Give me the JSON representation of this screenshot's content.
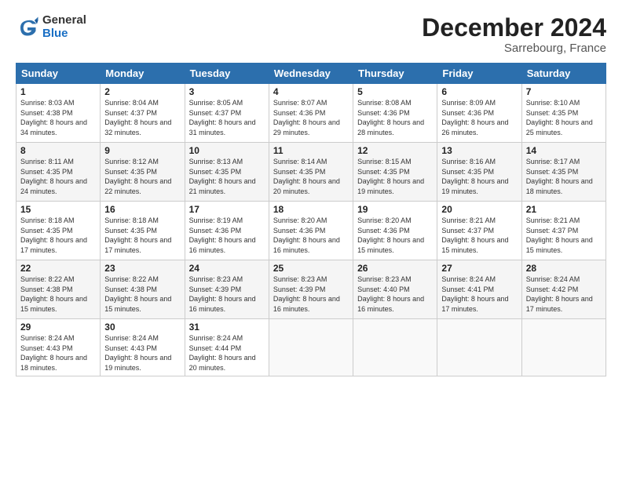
{
  "header": {
    "logo": {
      "general": "General",
      "blue": "Blue"
    },
    "title": "December 2024",
    "location": "Sarrebourg, France"
  },
  "calendar": {
    "days_of_week": [
      "Sunday",
      "Monday",
      "Tuesday",
      "Wednesday",
      "Thursday",
      "Friday",
      "Saturday"
    ],
    "weeks": [
      [
        null,
        {
          "date": "2",
          "sunrise": "8:04 AM",
          "sunset": "4:37 PM",
          "daylight": "8 hours and 32 minutes."
        },
        {
          "date": "3",
          "sunrise": "8:05 AM",
          "sunset": "4:37 PM",
          "daylight": "8 hours and 31 minutes."
        },
        {
          "date": "4",
          "sunrise": "8:07 AM",
          "sunset": "4:36 PM",
          "daylight": "8 hours and 29 minutes."
        },
        {
          "date": "5",
          "sunrise": "8:08 AM",
          "sunset": "4:36 PM",
          "daylight": "8 hours and 28 minutes."
        },
        {
          "date": "6",
          "sunrise": "8:09 AM",
          "sunset": "4:36 PM",
          "daylight": "8 hours and 26 minutes."
        },
        {
          "date": "7",
          "sunrise": "8:10 AM",
          "sunset": "4:35 PM",
          "daylight": "8 hours and 25 minutes."
        }
      ],
      [
        {
          "date": "1",
          "sunrise": "8:03 AM",
          "sunset": "4:38 PM",
          "daylight": "8 hours and 34 minutes."
        },
        {
          "date": "8",
          "sunrise": "8:11 AM",
          "sunset": "4:35 PM",
          "daylight": "8 hours and 24 minutes."
        },
        {
          "date": "9",
          "sunrise": "8:12 AM",
          "sunset": "4:35 PM",
          "daylight": "8 hours and 22 minutes."
        },
        {
          "date": "10",
          "sunrise": "8:13 AM",
          "sunset": "4:35 PM",
          "daylight": "8 hours and 21 minutes."
        },
        {
          "date": "11",
          "sunrise": "8:14 AM",
          "sunset": "4:35 PM",
          "daylight": "8 hours and 20 minutes."
        },
        {
          "date": "12",
          "sunrise": "8:15 AM",
          "sunset": "4:35 PM",
          "daylight": "8 hours and 19 minutes."
        },
        {
          "date": "13",
          "sunrise": "8:16 AM",
          "sunset": "4:35 PM",
          "daylight": "8 hours and 19 minutes."
        },
        {
          "date": "14",
          "sunrise": "8:17 AM",
          "sunset": "4:35 PM",
          "daylight": "8 hours and 18 minutes."
        }
      ],
      [
        {
          "date": "15",
          "sunrise": "8:18 AM",
          "sunset": "4:35 PM",
          "daylight": "8 hours and 17 minutes."
        },
        {
          "date": "16",
          "sunrise": "8:18 AM",
          "sunset": "4:35 PM",
          "daylight": "8 hours and 17 minutes."
        },
        {
          "date": "17",
          "sunrise": "8:19 AM",
          "sunset": "4:36 PM",
          "daylight": "8 hours and 16 minutes."
        },
        {
          "date": "18",
          "sunrise": "8:20 AM",
          "sunset": "4:36 PM",
          "daylight": "8 hours and 16 minutes."
        },
        {
          "date": "19",
          "sunrise": "8:20 AM",
          "sunset": "4:36 PM",
          "daylight": "8 hours and 15 minutes."
        },
        {
          "date": "20",
          "sunrise": "8:21 AM",
          "sunset": "4:37 PM",
          "daylight": "8 hours and 15 minutes."
        },
        {
          "date": "21",
          "sunrise": "8:21 AM",
          "sunset": "4:37 PM",
          "daylight": "8 hours and 15 minutes."
        }
      ],
      [
        {
          "date": "22",
          "sunrise": "8:22 AM",
          "sunset": "4:38 PM",
          "daylight": "8 hours and 15 minutes."
        },
        {
          "date": "23",
          "sunrise": "8:22 AM",
          "sunset": "4:38 PM",
          "daylight": "8 hours and 15 minutes."
        },
        {
          "date": "24",
          "sunrise": "8:23 AM",
          "sunset": "4:39 PM",
          "daylight": "8 hours and 16 minutes."
        },
        {
          "date": "25",
          "sunrise": "8:23 AM",
          "sunset": "4:39 PM",
          "daylight": "8 hours and 16 minutes."
        },
        {
          "date": "26",
          "sunrise": "8:23 AM",
          "sunset": "4:40 PM",
          "daylight": "8 hours and 16 minutes."
        },
        {
          "date": "27",
          "sunrise": "8:24 AM",
          "sunset": "4:41 PM",
          "daylight": "8 hours and 17 minutes."
        },
        {
          "date": "28",
          "sunrise": "8:24 AM",
          "sunset": "4:42 PM",
          "daylight": "8 hours and 17 minutes."
        }
      ],
      [
        {
          "date": "29",
          "sunrise": "8:24 AM",
          "sunset": "4:43 PM",
          "daylight": "8 hours and 18 minutes."
        },
        {
          "date": "30",
          "sunrise": "8:24 AM",
          "sunset": "4:43 PM",
          "daylight": "8 hours and 19 minutes."
        },
        {
          "date": "31",
          "sunrise": "8:24 AM",
          "sunset": "4:44 PM",
          "daylight": "8 hours and 20 minutes."
        },
        null,
        null,
        null,
        null
      ]
    ]
  }
}
